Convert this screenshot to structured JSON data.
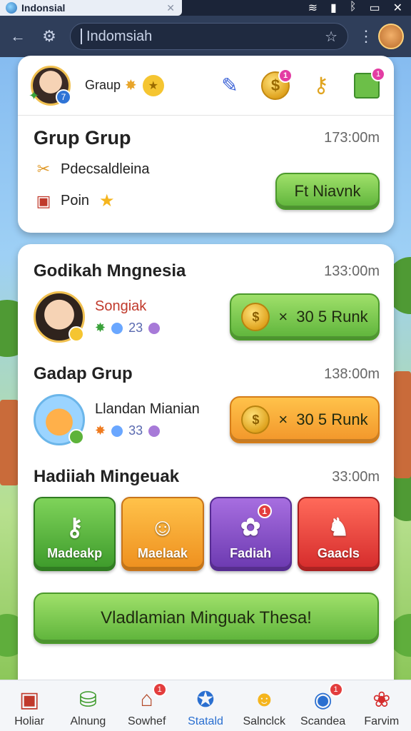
{
  "statusbar": {
    "app_title": "Indonsial",
    "right_icons": [
      "wifi-icon",
      "signal-icon",
      "bluetooth-icon",
      "window-icon",
      "close-icon"
    ]
  },
  "addressbar": {
    "url_text": "Indomsiah"
  },
  "header_card": {
    "group_label": "Graup",
    "avatar_badge": "7",
    "notif_counts": {
      "coin": "1",
      "drawer": "1"
    },
    "title": "Grup Grup",
    "time": "173:00m",
    "items": [
      {
        "label": "Pdecsaldleina",
        "icon": "ribbon-icon"
      },
      {
        "label": "Poin",
        "icon": "gift-icon"
      }
    ],
    "action_label": "Ft Niavnk"
  },
  "main_card": {
    "sections": [
      {
        "title": "Godikah Mngnesia",
        "time": "133:00m",
        "name": "Songiak",
        "stat_value": "23",
        "reward_multiplier": "×",
        "reward_label": "30 5 Runk"
      },
      {
        "title": "Gadap Grup",
        "time": "138:00m",
        "name": "Llandan Mianian",
        "stat_value": "33",
        "reward_multiplier": "×",
        "reward_label": "30 5 Runk"
      }
    ],
    "hadiah": {
      "title": "Hadiiah Mingeuak",
      "time": "33:00m",
      "tiles": [
        {
          "label": "Madeakp"
        },
        {
          "label": "Maelaak"
        },
        {
          "label": "Fadiah",
          "notif": "1"
        },
        {
          "label": "Gaacls"
        }
      ]
    },
    "big_button_label": "Vladlamian Minguak Thesa!"
  },
  "bottomnav": {
    "items": [
      {
        "label": "Holiar"
      },
      {
        "label": "Alnung"
      },
      {
        "label": "Sowhef",
        "notif": "1"
      },
      {
        "label": "Statald"
      },
      {
        "label": "Salnclck"
      },
      {
        "label": "Scandea",
        "notif": "1"
      },
      {
        "label": "Farvim"
      }
    ],
    "active_index": 3
  },
  "colors": {
    "accent_green": "#5db33a",
    "accent_orange": "#f2962a",
    "tile_purple": "#6b39b0",
    "tile_red": "#d52b2b"
  }
}
